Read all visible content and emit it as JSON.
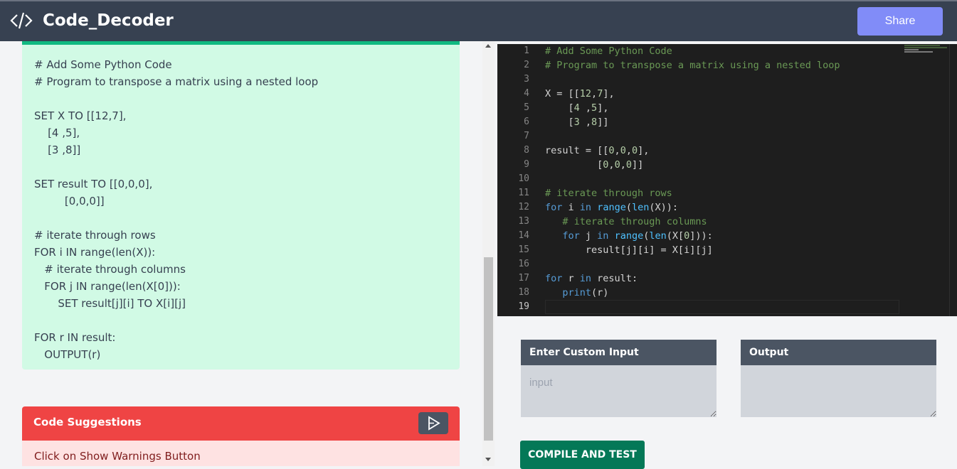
{
  "app": {
    "title": "Code_Decoder",
    "share_label": "Share"
  },
  "pseudocode": {
    "lines": [
      "# Add Some Python Code",
      "# Program to transpose a matrix using a nested loop",
      "",
      "SET X TO [[12,7],",
      "    [4 ,5],",
      "    [3 ,8]]",
      "",
      "SET result TO [[0,0,0],",
      "         [0,0,0]]",
      "",
      "# iterate through rows",
      "FOR i IN range(len(X)):",
      "   # iterate through columns",
      "   FOR j IN range(len(X[0])):",
      "       SET result[j][i] TO X[i][j]",
      "",
      "FOR r IN result:",
      "   OUTPUT(r)"
    ]
  },
  "suggestions": {
    "title": "Code Suggestions",
    "body": "Click on Show Warnings Button"
  },
  "editor": {
    "line_numbers": [
      "1",
      "2",
      "3",
      "4",
      "5",
      "6",
      "7",
      "8",
      "9",
      "10",
      "11",
      "12",
      "13",
      "14",
      "15",
      "16",
      "17",
      "18",
      "19"
    ]
  },
  "io": {
    "input_title": "Enter Custom Input",
    "input_placeholder": "input",
    "output_title": "Output",
    "compile_label": "COMPILE AND TEST"
  },
  "colors": {
    "accent": "#818cf8",
    "green": "#10b981",
    "red": "#ef4444",
    "dark": "#374151"
  }
}
